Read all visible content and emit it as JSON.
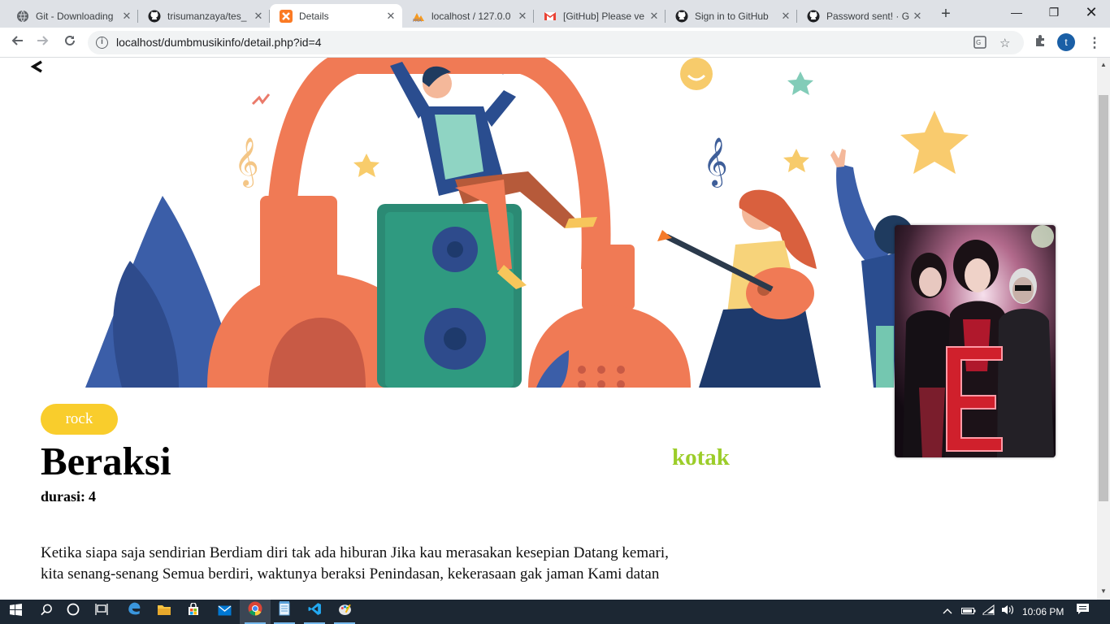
{
  "browser": {
    "tabs": [
      {
        "title": "Git - Downloading",
        "icon": "globe-icon"
      },
      {
        "title": "trisumanzaya/tes_",
        "icon": "github-icon"
      },
      {
        "title": "Details",
        "icon": "xampp-icon",
        "active": true
      },
      {
        "title": "localhost / 127.0.0",
        "icon": "phpmyadmin-icon"
      },
      {
        "title": "[GitHub] Please ve",
        "icon": "gmail-icon"
      },
      {
        "title": "Sign in to GitHub",
        "icon": "github-icon"
      },
      {
        "title": "Password sent! · G",
        "icon": "github-icon"
      }
    ],
    "url": "localhost/dumbmusikinfo/detail.php?id=4",
    "profile_initial": "t"
  },
  "page": {
    "back_icon": "back-arrow-icon",
    "genre": "rock",
    "title": "Beraksi",
    "artist": "kotak",
    "duration_label": "durasi:",
    "duration_value": "4",
    "lyrics_line1": "Ketika siapa saja sendirian Berdiam diri tak ada hiburan Jika kau merasakan kesepian Datang kemari,",
    "lyrics_line2": "kita senang-senang Semua berdiri, waktunya beraksi Penindasan, kekerasaan gak jaman Kami datan",
    "colors": {
      "genre_pill": "#f9cd2c",
      "artist": "#9ccd2a"
    }
  },
  "taskbar": {
    "time": "10:06 PM"
  }
}
